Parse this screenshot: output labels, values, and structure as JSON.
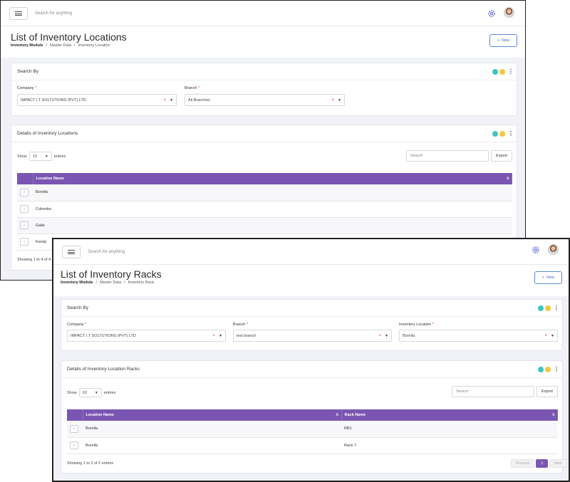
{
  "colors": {
    "accent": "#7a56b2",
    "teal": "#3cc7c0",
    "yellow": "#f5c842",
    "link": "#3d6fc4",
    "required": "#e23b3b"
  },
  "locations_window": {
    "topbar": {
      "search_placeholder": "Search for anything",
      "menu_icon": "hamburger-icon",
      "settings_icon": "gear-icon"
    },
    "title": "List of Inventory Locations",
    "breadcrumb": [
      "Inventory Module",
      "/",
      "Master Data",
      "/",
      "Inventory Location"
    ],
    "new_label": "New",
    "search_panel": {
      "title": "Search By",
      "company_label": "Company",
      "company_value": "IMPACT I.T SOLTUTIONS (PVT) LTD",
      "branch_label": "Branch",
      "branch_value": "All Branches"
    },
    "details_panel": {
      "title": "Details of Inventory Locations",
      "show_label": "Show",
      "entries_value": "10",
      "entries_label": "entries",
      "search_placeholder": "Search",
      "export_label": "Export",
      "columns": [
        "Location Name"
      ],
      "rows": [
        {
          "btn": "⁝",
          "name": "Borella"
        },
        {
          "btn": "⁝",
          "name": "Colombo"
        },
        {
          "btn": "⁝",
          "name": "Galle"
        },
        {
          "btn": "⁝",
          "name": "Kandy"
        }
      ],
      "info": "Showing 1 to 4 of 4 e"
    }
  },
  "racks_window": {
    "topbar": {
      "search_placeholder": "Search for anything",
      "menu_icon": "hamburger-icon",
      "settings_icon": "gear-icon"
    },
    "title": "List of Inventory Racks",
    "breadcrumb": [
      "Inventory Module",
      "/",
      "Master Data",
      "/",
      "Inventory Rack"
    ],
    "new_label": "New",
    "search_panel": {
      "title": "Search By",
      "company_label": "Company",
      "company_value": "IMPACT I.T SOLTUTIONS (PVT) LTD",
      "branch_label": "Branch",
      "branch_value": "test branch",
      "location_label": "Inventory Location",
      "location_value": "Borella"
    },
    "details_panel": {
      "title": "Details of Inventory Location Racks",
      "show_label": "Show",
      "entries_value": "10",
      "entries_label": "entries",
      "search_placeholder": "Search",
      "export_label": "Export",
      "columns": [
        "Location Name",
        "Rack Name"
      ],
      "rows": [
        {
          "btn": "⁝",
          "location": "Borella",
          "rack": "RB1"
        },
        {
          "btn": "⁝",
          "location": "Borella",
          "rack": "Rack 7"
        }
      ],
      "info": "Showing 1 to 2 of 2 entries",
      "pager": {
        "previous": "Previous",
        "current": "1",
        "next": "Next"
      }
    }
  }
}
